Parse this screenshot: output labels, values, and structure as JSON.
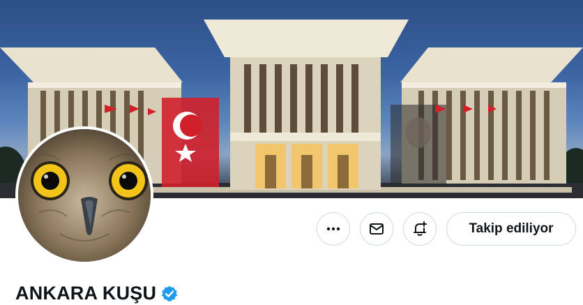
{
  "profile": {
    "display_name": "ANKARA KUŞU",
    "verified": true,
    "banner_image": "presidential-palace-photo",
    "avatar_image": "owl-face-photo"
  },
  "actions": {
    "more_icon": "more-horizontal-icon",
    "message_icon": "mail-icon",
    "notify_icon": "bell-plus-icon",
    "follow_label": "Takip ediliyor"
  },
  "colors": {
    "verified_blue": "#1d9bf0",
    "text": "#0f1419",
    "border": "#cfd9de"
  }
}
